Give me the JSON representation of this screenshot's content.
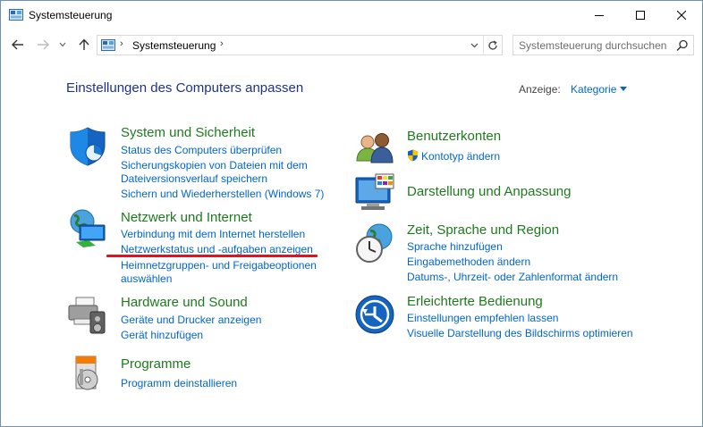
{
  "window": {
    "title": "Systemsteuerung"
  },
  "address": {
    "crumb": "Systemsteuerung",
    "separator": "›"
  },
  "search": {
    "placeholder": "Systemsteuerung durchsuchen"
  },
  "header": {
    "heading": "Einstellungen des Computers anpassen",
    "view_label": "Anzeige:",
    "view_value": "Kategorie"
  },
  "categories": {
    "system": {
      "title": "System und Sicherheit",
      "links": [
        "Status des Computers überprüfen",
        "Sicherungskopien von Dateien mit dem",
        "Dateiversionsverlauf speichern",
        "Sichern und Wiederherstellen (Windows 7)"
      ]
    },
    "network": {
      "title": "Netzwerk und Internet",
      "links": [
        "Verbindung mit dem Internet herstellen",
        "Netzwerkstatus und -aufgaben anzeigen",
        "Heimnetzgruppen- und Freigabeoptionen",
        "auswählen"
      ]
    },
    "hardware": {
      "title": "Hardware und Sound",
      "links": [
        "Geräte und Drucker anzeigen",
        "Gerät hinzufügen"
      ]
    },
    "programs": {
      "title": "Programme",
      "links": [
        "Programm deinstallieren"
      ]
    },
    "accounts": {
      "title": "Benutzerkonten",
      "links": [
        "Kontotyp ändern"
      ]
    },
    "appearance": {
      "title": "Darstellung und Anpassung"
    },
    "clock": {
      "title": "Zeit, Sprache und Region",
      "links": [
        "Sprache hinzufügen",
        "Eingabemethoden ändern",
        "Datums-, Uhrzeit- oder Zahlenformat ändern"
      ]
    },
    "ease": {
      "title": "Erleichterte Bedienung",
      "links": [
        "Einstellungen empfehlen lassen",
        "Visuelle Darstellung des Bildschirms optimieren"
      ]
    }
  },
  "colors": {
    "heading": "#1e3287",
    "category_title": "#1e7a1e",
    "link": "#0066cc",
    "annotation": "#e0141e"
  }
}
